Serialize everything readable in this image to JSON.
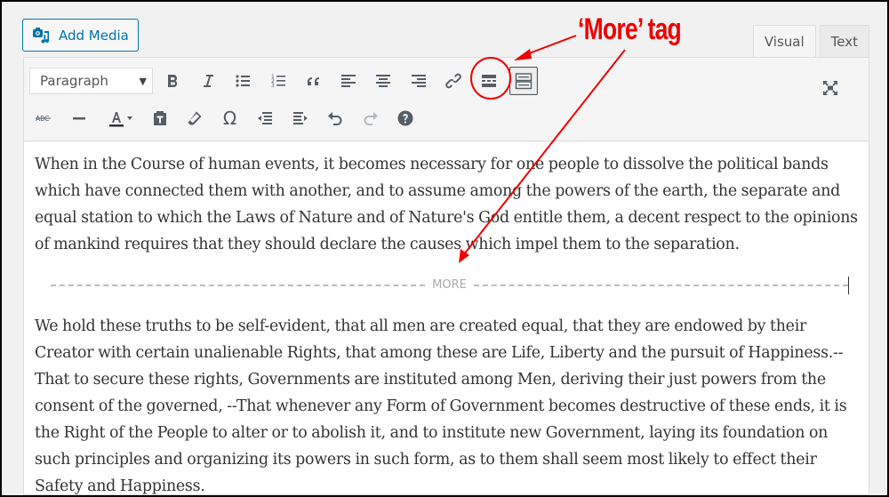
{
  "header": {
    "add_media_label": "Add Media",
    "tabs": [
      {
        "label": "Visual",
        "active": true
      },
      {
        "label": "Text",
        "active": false
      }
    ]
  },
  "toolbar": {
    "format_select": {
      "value": "Paragraph"
    },
    "row1": [
      "bold",
      "italic",
      "bulleted-list",
      "numbered-list",
      "blockquote",
      "align-left",
      "align-center",
      "align-right",
      "insert-link",
      "insert-read-more-tag",
      "toolbar-toggle"
    ],
    "row2": [
      "strikethrough",
      "horizontal-line",
      "text-color",
      "paste-as-text",
      "clear-formatting",
      "special-character",
      "decrease-indent",
      "increase-indent",
      "undo",
      "redo",
      "keyboard-shortcuts"
    ],
    "fullscreen": "distraction-free-writing"
  },
  "content": {
    "paragraph1": "When in the Course of human events, it becomes necessary for one people to dissolve the political bands which have connected them with another, and to assume among the powers of the earth, the separate and equal station to which the Laws of Nature and of Nature's God entitle them, a decent respect to the opinions of mankind requires that they should declare the causes which impel them to the separation.",
    "more_label": "MORE",
    "paragraph2": "We hold these truths to be self-evident, that all men are created equal, that they are endowed by their Creator with certain unalienable Rights, that among these are Life, Liberty and the pursuit of Happiness.--That to secure these rights, Governments are instituted among Men, deriving their just powers from the consent of the governed, --That whenever any Form of Government becomes destructive of these ends, it is the Right of the People to alter or to abolish it, and to institute new Government, laying its foundation on such principles and organizing its powers in such form, as to them shall seem most likely to effect their Safety and Happiness."
  },
  "annotation": {
    "label": "‘More’ tag",
    "color": "#e00000"
  },
  "colors": {
    "accent": "#0073aa",
    "icon": "#555d66",
    "background": "#f1f1f1"
  }
}
